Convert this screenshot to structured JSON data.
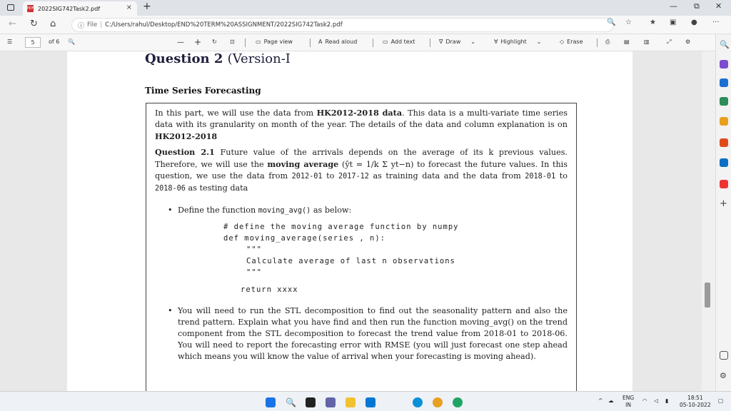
{
  "tab": {
    "title": "2022SIG742Task2.pdf",
    "close": "×",
    "new": "+"
  },
  "window": {
    "min": "—",
    "restore": "⧉",
    "close": "✕"
  },
  "address": {
    "file_label": "File",
    "separator": "|",
    "url": "C:/Users/rahul/Desktop/END%20TERM%20ASSIGNMENT/2022SIG742Task2.pdf"
  },
  "toolbar": {
    "page": "5",
    "of": "of 6",
    "zoom_out": "—",
    "zoom_in": "+",
    "page_view": "Page view",
    "read_aloud": "Read aloud",
    "add_text": "Add text",
    "draw": "Draw",
    "highlight": "Highlight",
    "erase": "Erase"
  },
  "doc": {
    "question_title": "Question 2",
    "question_version": "(Version-I",
    "section_title": "Time Series Forecasting",
    "intro_1": "In this part, we will use the data from ",
    "intro_bold": "HK2012-2018 data",
    "intro_2": ". This data is a multi-variate time series data with its granularity on month of the year. The details of the data and column explanation is on ",
    "intro_bold2": "HK2012-2018",
    "q21_label": "Question 2.1",
    "q21_text": " Future value of the arrivals depends on the average of its k previous values. Therefore, we will use the ",
    "q21_bold": "moving average",
    "q21_formula": "(ŷt = 1/k Σ yt−n)",
    "q21_text2": " to forecast the future values. In this question, we use the data from ",
    "train_start": "2012-01",
    "q21_to": " to ",
    "train_end": "2017-12",
    "q21_text3": " as training data and the data from ",
    "test_start": "2018-01",
    "test_end": "2018-06",
    "q21_text4": " as testing data",
    "bullet1_pre": "Define the function ",
    "bullet1_code": "moving_avg()",
    "bullet1_post": " as below:",
    "code_1": "# define the moving average function by numpy",
    "code_2": "def moving_average(series , n):",
    "code_3": "\"\"\"",
    "code_4": "Calculate average of last n observations",
    "code_5": "\"\"\"",
    "code_6": "return xxxx",
    "bullet2": "You will need to run the STL decomposition to find out the seasonality pattern and also the trend pattern. Explain what you have find and then run the function moving_avg() on the trend component from the STL decomposition to forecast the trend value from 2018-01 to 2018-06. You will need to report the forecasting error with RMSE (you will just forecast one step ahead which means you will know the value of arrival when your forecasting is moving ahead)."
  },
  "taskbar": {
    "lang": "ENG",
    "lang2": "IN",
    "time": "18:51",
    "date": "05-10-2022"
  }
}
